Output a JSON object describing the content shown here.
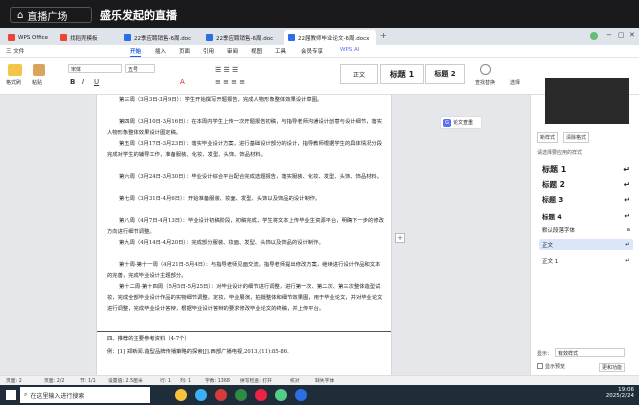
{
  "live": {
    "back_label": "直播广场",
    "title": "盛乐发起的直播"
  },
  "tabs": [
    {
      "label": "WPS Office"
    },
    {
      "label": "找稻壳模板"
    },
    {
      "label": "22季应聘销售-6周.doc"
    },
    {
      "label": "22季应聘销售-6周.doc"
    },
    {
      "label": "22届教师毕业论文-6周.docx"
    }
  ],
  "new_tab": "+",
  "menus": [
    "三 文件",
    "开始",
    "插入",
    "页面",
    "引用",
    "审阅",
    "视图",
    "工具",
    "会员专享",
    "WPS AI"
  ],
  "ribbon": {
    "format_painter": "格式刷",
    "paste": "粘贴",
    "font": "宋体",
    "size": "五号",
    "bold": "B",
    "italic": "I",
    "underline": "U",
    "styles": [
      "正文",
      "标题 1",
      "标题 2"
    ],
    "find": "查找替换",
    "select": "选择"
  },
  "document": {
    "paragraphs": [
      "第三周（3月3日-3月9日）：学生开始撰写开题报告，完成人物形象整体效果设计草图。",
      "第四周（3月10日-3月16日）：在本周内学生上传一次开题报告初稿，与指导老师沟通设计创意与设计细节，落实人物形象整体效果设计图定稿。",
      "第五周（3月17日-3月23日）：落实毕业设计方案，进行基础设计部分的设计，指导教师根据学生的具体情况分段完成对学生的辅导工作，准备服装、化妆、发型、头饰、饰品材料。",
      "第六周（3月24日-3月30日）：毕业设计综合平台配合完成选题报告，落实服装、化妆、发型、头饰、饰品材料。",
      "第七周（3月31日-4月6日）：开始准备服装、妆面、发型、头饰以及饰品的设计制作。",
      "第八周（4月7日-4月13日）：毕业设计初稿阶段，初稿完成，学生将文本上传毕业生资源平台，明确下一步的修改方向进行细节调整。",
      "第九周（4月14日-4月20日）：完成部分服装、妆面、发型、头饰以及饰品的设计制作。",
      "第十周-第十一周（4月21日-5月4日）：与指导老师见面交流，指导老师提出修改方案，继续进行设计作品和文本的完善，完成毕业设计主题部分。",
      "第十二周-第十四周（5月5日-5月25日）：对毕业设计的细节进行调整，进行第一次、第二次、第三次整体造型试妆，完成全部毕业设计作品的实物细节调整，定妆，毕业展演，拍摄整体和细节效果图，用于毕业论文，并对毕业论文进行调整，完成毕业设计答辩，根据毕业设计答辩的要求修改毕业论文的终稿，并上传平台。"
    ],
    "ref_heading": "四、推荐的主要参考资料（4-7个）",
    "ref_item": "例：[1] 郑新闻.造型品牌传播策略的探索[J].西部广播电视,2013,(11):85-86."
  },
  "ai_badge": "论文查重",
  "panel": {
    "new_style": "新样式",
    "clear_format": "清除格式",
    "section_label": "请选择要应用的样式",
    "styles": [
      {
        "label": "标题 1",
        "mark": "↵"
      },
      {
        "label": "标题 2",
        "mark": "↵"
      },
      {
        "label": "标题 3",
        "mark": "↵"
      },
      {
        "label": "标题 4",
        "mark": "↵"
      },
      {
        "label": "默认段落字体",
        "mark": "a"
      },
      {
        "label": "正文",
        "mark": "↵"
      },
      {
        "label": "正文 1",
        "mark": "↵"
      }
    ],
    "show_label": "显示：",
    "show_value": "有效样式",
    "preview_label": "显示预览",
    "mini_button": "更和功能"
  },
  "status": {
    "page": "页面: 2",
    "pages": "页面: 2/2",
    "section": "节: 1/1",
    "settings": "设置值: 2.5厘米",
    "row": "行: 1",
    "col": "列: 1",
    "words": "字数: 1368",
    "spell": "拼写检查: 打开",
    "proof": "校对",
    "font_missing": "缺失字体"
  },
  "taskbar": {
    "search": "在这里输入进行搜索",
    "time": "19:06",
    "date": "2025/2/24"
  }
}
